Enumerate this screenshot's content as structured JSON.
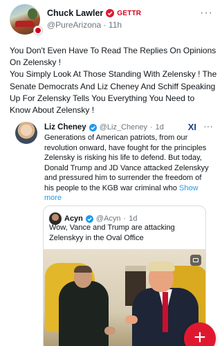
{
  "post": {
    "author_name": "Chuck Lawler",
    "network": "GETTR",
    "handle": "@PureArizona",
    "separator": "·",
    "time": "11h",
    "more_icon": "more-horizontal-icon",
    "body_lines": [
      "You Don't Even Have To Read The Replies On Opinions On Zelensky !",
      "You Simply Look At Those Standing With Zelensky ! The Senate Democrats And Liz Cheney And Schiff Speaking Up For Zelensky Tells You Everything You Need to Know About Zelensky !"
    ]
  },
  "quote": {
    "author_name": "Liz Cheney",
    "handle": "@Liz_Cheney",
    "separator": "·",
    "time": "1d",
    "source_logo": "XI",
    "body": "Generations of American patriots, from our revolution onward, have fought for  the principles Zelensky is risking his life to defend. But today, Donald Trump and JD Vance attacked Zelenskyy and pressured him to surrender the freedom of his people to the KGB war criminal who",
    "show_more": "Show more"
  },
  "nested_quote": {
    "author_name": "Acyn",
    "handle": "@Acyn",
    "separator": "·",
    "time": "1d",
    "body": "Wow, Vance and Trump are attacking Zelenskyy in the Oval Office"
  },
  "fab": {
    "label": "+",
    "icon": "plus-icon"
  },
  "colors": {
    "brand_red": "#e0182f",
    "link_blue": "#1d9bf0",
    "verified_blue": "#1d9bf0",
    "muted": "#6b7680"
  }
}
